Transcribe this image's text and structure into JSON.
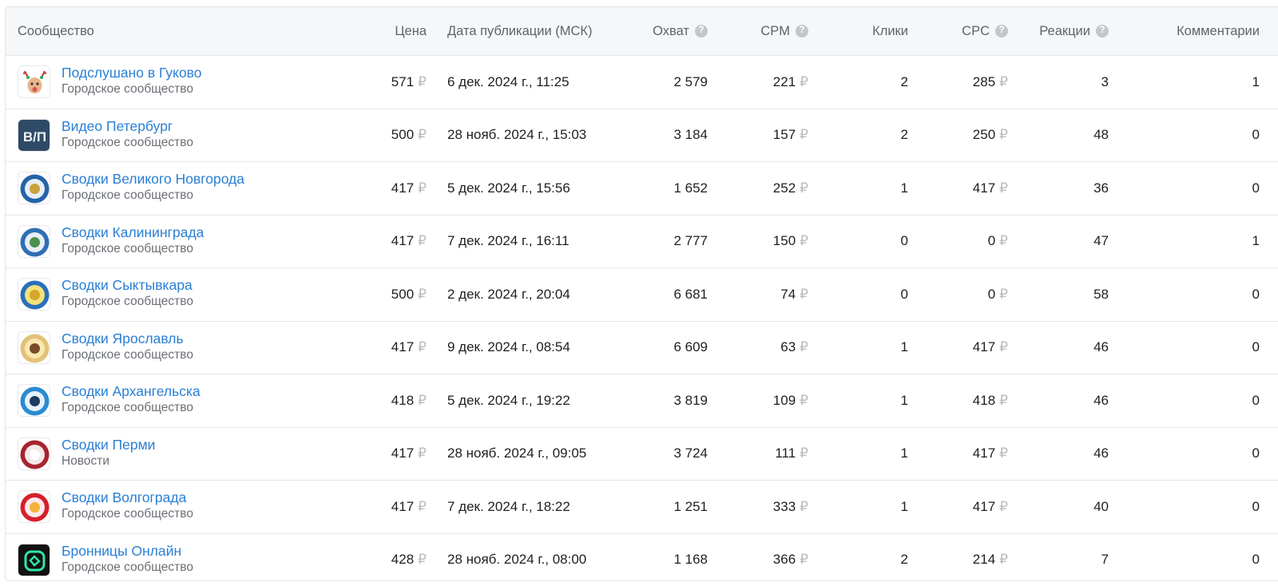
{
  "headers": {
    "community": "Сообщество",
    "price": "Цена",
    "date": "Дата публикации (МСК)",
    "reach": "Охват",
    "cpm": "CPM",
    "clicks": "Клики",
    "cpc": "CPC",
    "reactions": "Реакции",
    "comments": "Комментарии",
    "help_glyph": "?"
  },
  "currency": "₽",
  "colors": {
    "link": "#2a7fd4",
    "muted": "#6b6f76",
    "header_bg": "#f6f7f9",
    "currency": "#b8bac0"
  },
  "rows": [
    {
      "name": "Подслушано в Гуково",
      "type": "Городское сообщество",
      "price": "571",
      "date": "6 дек. 2024 г., 11:25",
      "reach": "2 579",
      "cpm": "221",
      "clicks": "2",
      "cpc": "285",
      "reactions": "3",
      "comments": "1",
      "avatar": "deer-avatar-icon"
    },
    {
      "name": "Видео Петербург",
      "type": "Городское сообщество",
      "price": "500",
      "date": "28 нояб. 2024 г., 15:03",
      "reach": "3 184",
      "cpm": "157",
      "clicks": "2",
      "cpc": "250",
      "reactions": "48",
      "comments": "0",
      "avatar": "vp-logo-icon",
      "avatar_text": "В/П"
    },
    {
      "name": "Сводки Великого Новгорода",
      "type": "Городское сообщество",
      "price": "417",
      "date": "5 дек. 2024 г., 15:56",
      "reach": "1 652",
      "cpm": "252",
      "clicks": "1",
      "cpc": "417",
      "reactions": "36",
      "comments": "0",
      "avatar": "vestnik-novgorod-emblem-icon"
    },
    {
      "name": "Сводки Калининграда",
      "type": "Городское сообщество",
      "price": "417",
      "date": "7 дек. 2024 г., 16:11",
      "reach": "2 777",
      "cpm": "150",
      "clicks": "0",
      "cpc": "0",
      "reactions": "47",
      "comments": "1",
      "avatar": "vestnik-kaliningrad-emblem-icon"
    },
    {
      "name": "Сводки Сыктывкара",
      "type": "Городское сообщество",
      "price": "500",
      "date": "2 дек. 2024 г., 20:04",
      "reach": "6 681",
      "cpm": "74",
      "clicks": "0",
      "cpc": "0",
      "reactions": "58",
      "comments": "0",
      "avatar": "vestnik-syktyvkar-emblem-icon"
    },
    {
      "name": "Сводки Ярославль",
      "type": "Городское сообщество",
      "price": "417",
      "date": "9 дек. 2024 г., 08:54",
      "reach": "6 609",
      "cpm": "63",
      "clicks": "1",
      "cpc": "417",
      "reactions": "46",
      "comments": "0",
      "avatar": "vestnik-yaroslavl-emblem-icon"
    },
    {
      "name": "Сводки Архангельска",
      "type": "Городское сообщество",
      "price": "418",
      "date": "5 дек. 2024 г., 19:22",
      "reach": "3 819",
      "cpm": "109",
      "clicks": "1",
      "cpc": "418",
      "reactions": "46",
      "comments": "0",
      "avatar": "vestnik-arkhangelsk-emblem-icon"
    },
    {
      "name": "Сводки Перми",
      "type": "Новости",
      "price": "417",
      "date": "28 нояб. 2024 г., 09:05",
      "reach": "3 724",
      "cpm": "111",
      "clicks": "1",
      "cpc": "417",
      "reactions": "46",
      "comments": "0",
      "avatar": "vestnik-perm-emblem-icon"
    },
    {
      "name": "Сводки Волгограда",
      "type": "Городское сообщество",
      "price": "417",
      "date": "7 дек. 2024 г., 18:22",
      "reach": "1 251",
      "cpm": "333",
      "clicks": "1",
      "cpc": "417",
      "reactions": "40",
      "comments": "0",
      "avatar": "vestnik-volgograd-emblem-icon"
    },
    {
      "name": "Бронницы Онлайн",
      "type": "Городское сообщество",
      "price": "428",
      "date": "28 нояб. 2024 г., 08:00",
      "reach": "1 168",
      "cpm": "366",
      "clicks": "2",
      "cpc": "214",
      "reactions": "7",
      "comments": "0",
      "avatar": "bronnitsy-online-logo-icon"
    }
  ]
}
